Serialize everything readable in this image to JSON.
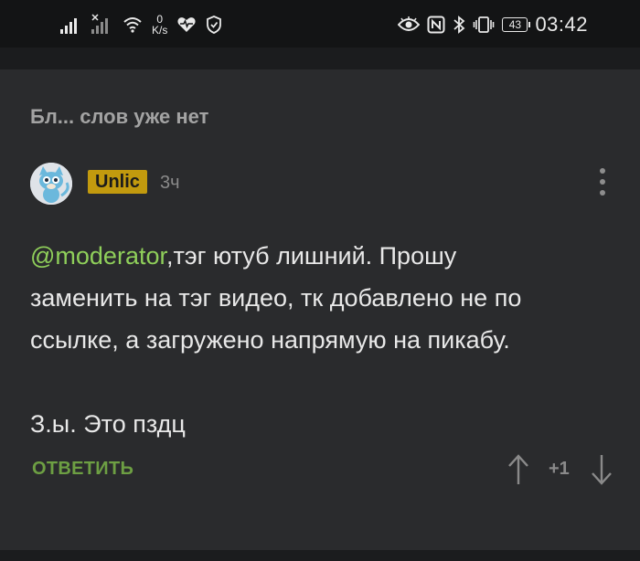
{
  "status_bar": {
    "speed_value": "0",
    "speed_unit": "K/s",
    "battery": "43",
    "time": "03:42",
    "icons": [
      "signal-icon",
      "signal-x-icon",
      "wifi-icon",
      "heart-pulse-icon",
      "shield-icon",
      "eye-icon",
      "nfc-icon",
      "bluetooth-icon",
      "vibrate-icon",
      "battery-icon"
    ]
  },
  "post": {
    "title": "Бл... слов уже нет"
  },
  "comment": {
    "author": "Unlic",
    "time": "3ч",
    "mention": "@moderator",
    "text_line1": ",тэг ютуб лишний. Прошу",
    "text_line2": "заменить на тэг видео, тк добавлено не по",
    "text_line3": "ссылке, а загружено напрямую на пикабу.",
    "text_line4": "З.ы. Это пздц",
    "reply_label": "ОТВЕТИТЬ",
    "rating": "+1"
  },
  "colors": {
    "background": "#2a2b2d",
    "username_badge": "#c29a0e",
    "mention": "#8fcf5a",
    "reply": "#6d9f43"
  }
}
